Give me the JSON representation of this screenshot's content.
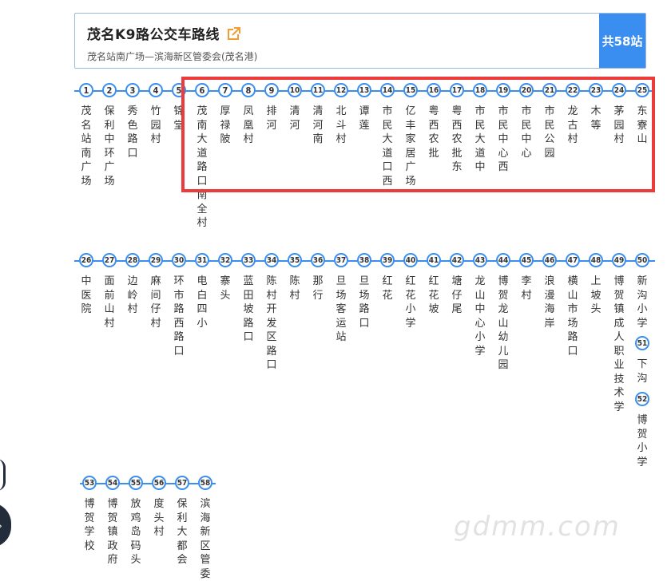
{
  "header": {
    "title": "茂名K9路公交车路线",
    "route": "茂名站南广场—滨海新区管委会(茂名港)",
    "count": "共58站"
  },
  "stops": [
    {
      "no": "1",
      "name": "茂名站南广场"
    },
    {
      "no": "2",
      "name": "保利中环广场"
    },
    {
      "no": "3",
      "name": "秀色路口"
    },
    {
      "no": "4",
      "name": "竹园村"
    },
    {
      "no": "5",
      "name": "锦堂"
    },
    {
      "no": "6",
      "name": "茂南大道路口南全村"
    },
    {
      "no": "7",
      "name": "厚禄陂"
    },
    {
      "no": "8",
      "name": "凤凰村"
    },
    {
      "no": "9",
      "name": "排河"
    },
    {
      "no": "10",
      "name": "清河"
    },
    {
      "no": "11",
      "name": "清河南"
    },
    {
      "no": "12",
      "name": "北斗村"
    },
    {
      "no": "13",
      "name": "谭莲"
    },
    {
      "no": "14",
      "name": "市民大道口西"
    },
    {
      "no": "15",
      "name": "亿丰家居广场"
    },
    {
      "no": "16",
      "name": "粤西农批"
    },
    {
      "no": "17",
      "name": "粤西农批东"
    },
    {
      "no": "18",
      "name": "市民大道中"
    },
    {
      "no": "19",
      "name": "市民中心西"
    },
    {
      "no": "20",
      "name": "市民中心"
    },
    {
      "no": "21",
      "name": "市民公园"
    },
    {
      "no": "22",
      "name": "龙古村"
    },
    {
      "no": "23",
      "name": "木等"
    },
    {
      "no": "24",
      "name": "茅园村"
    },
    {
      "no": "25",
      "name": "东寮山"
    },
    {
      "no": "26",
      "name": "中医院"
    },
    {
      "no": "27",
      "name": "面前山村"
    },
    {
      "no": "28",
      "name": "边岭村"
    },
    {
      "no": "29",
      "name": "麻间仔村"
    },
    {
      "no": "30",
      "name": "环市路西路口"
    },
    {
      "no": "31",
      "name": "电白四小"
    },
    {
      "no": "32",
      "name": "寨头"
    },
    {
      "no": "33",
      "name": "蓝田坡路口"
    },
    {
      "no": "34",
      "name": "陈村开发区路口"
    },
    {
      "no": "35",
      "name": "陈村"
    },
    {
      "no": "36",
      "name": "那行"
    },
    {
      "no": "37",
      "name": "旦场客运站"
    },
    {
      "no": "38",
      "name": "旦场路口"
    },
    {
      "no": "39",
      "name": "红花"
    },
    {
      "no": "40",
      "name": "红花小学"
    },
    {
      "no": "41",
      "name": "红花坡"
    },
    {
      "no": "42",
      "name": "塘仔尾"
    },
    {
      "no": "43",
      "name": "龙山中心小学"
    },
    {
      "no": "44",
      "name": "博贺龙山幼儿园"
    },
    {
      "no": "45",
      "name": "李村"
    },
    {
      "no": "46",
      "name": "浪漫海岸"
    },
    {
      "no": "47",
      "name": "横山市场路口"
    },
    {
      "no": "48",
      "name": "上坡头"
    },
    {
      "no": "49",
      "name": "博贺镇成人职业技术学"
    },
    {
      "no": "50",
      "name": "新沟小学"
    },
    {
      "no": "51",
      "name": "下沟"
    },
    {
      "no": "52",
      "name": "博贺小学"
    },
    {
      "no": "53",
      "name": "博贺学校"
    },
    {
      "no": "54",
      "name": "博贺镇政府"
    },
    {
      "no": "55",
      "name": "放鸡岛码头"
    },
    {
      "no": "56",
      "name": "度头村"
    },
    {
      "no": "57",
      "name": "保利大都会"
    },
    {
      "no": "58",
      "name": "滨海新区管委"
    }
  ],
  "watermark": "gdmm.com"
}
